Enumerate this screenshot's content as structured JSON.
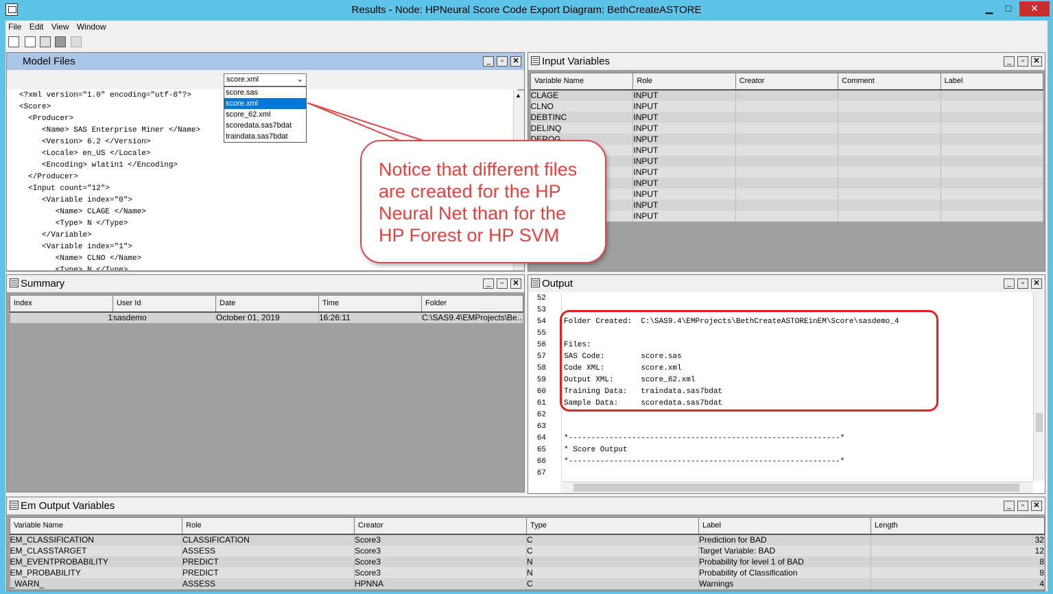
{
  "window": {
    "title": "Results - Node: HPNeural Score Code Export  Diagram: BethCreateASTORE",
    "min": "▁",
    "max": "□",
    "close": "✕"
  },
  "menu": [
    "File",
    "Edit",
    "View",
    "Window"
  ],
  "model_files": {
    "title": "Model Files",
    "dropdown_value": "score.xml",
    "dropdown_options": [
      "score.sas",
      "score.xml",
      "score_62.xml",
      "scoredata.sas7bdat",
      "traindata.sas7bdat"
    ],
    "lines": [
      "<?xml version=\"1.0\" encoding=\"utf-8\"?>",
      "<Score>",
      "  <Producer>",
      "     <Name> SAS Enterprise Miner </Name>",
      "     <Version> 6.2 </Version>",
      "     <Locale> en_US </Locale>",
      "     <Encoding> wlatin1 </Encoding>",
      "  </Producer>",
      "  <Input count=\"12\">",
      "     <Variable index=\"0\">",
      "        <Name> CLAGE </Name>",
      "        <Type> N </Type>",
      "     </Variable>",
      "     <Variable index=\"1\">",
      "        <Name> CLNO </Name>",
      "        <Type> N </Type>"
    ]
  },
  "input_variables": {
    "title": "Input Variables",
    "columns": [
      "Variable Name",
      "Role",
      "Creator",
      "Comment",
      "Label"
    ],
    "rows": [
      [
        "CLAGE",
        "INPUT"
      ],
      [
        "CLNO",
        "INPUT"
      ],
      [
        "DEBTINC",
        "INPUT"
      ],
      [
        "DELINQ",
        "INPUT"
      ],
      [
        "DEROG",
        "INPUT"
      ],
      [
        "",
        "INPUT"
      ],
      [
        "",
        "INPUT"
      ],
      [
        "",
        "INPUT"
      ],
      [
        "",
        "INPUT"
      ],
      [
        "",
        "INPUT"
      ],
      [
        "",
        "INPUT"
      ],
      [
        "",
        "INPUT"
      ]
    ]
  },
  "summary": {
    "title": "Summary",
    "columns": [
      "Index",
      "User Id",
      "Date",
      "Time",
      "Folder"
    ],
    "rows": [
      [
        "1",
        "sasdemo",
        "October 01, 2019",
        "16:26:11",
        "C:\\SAS9.4\\EMProjects\\Be..."
      ]
    ]
  },
  "output": {
    "title": "Output",
    "lines": [
      {
        "n": "52",
        "t": ""
      },
      {
        "n": "53",
        "t": ""
      },
      {
        "n": "54",
        "t": "Folder Created:  C:\\SAS9.4\\EMProjects\\BethCreateASTOREinEM\\Score\\sasdemo_4"
      },
      {
        "n": "55",
        "t": ""
      },
      {
        "n": "56",
        "t": "Files:"
      },
      {
        "n": "57",
        "t": "SAS Code:        score.sas"
      },
      {
        "n": "58",
        "t": "Code XML:        score.xml"
      },
      {
        "n": "59",
        "t": "Output XML:      score_62.xml"
      },
      {
        "n": "60",
        "t": "Training Data:   traindata.sas7bdat"
      },
      {
        "n": "61",
        "t": "Sample Data:     scoredata.sas7bdat"
      },
      {
        "n": "62",
        "t": ""
      },
      {
        "n": "63",
        "t": ""
      },
      {
        "n": "64",
        "t": "*------------------------------------------------------------*"
      },
      {
        "n": "65",
        "t": "* Score Output"
      },
      {
        "n": "66",
        "t": "*------------------------------------------------------------*"
      },
      {
        "n": "67",
        "t": ""
      }
    ]
  },
  "em_output": {
    "title": "Em Output Variables",
    "columns": [
      "Variable Name",
      "Role",
      "Creator",
      "Type",
      "Label",
      "Length"
    ],
    "rows": [
      [
        "EM_CLASSIFICATION",
        "CLASSIFICATION",
        "Score3",
        "C",
        "Prediction for BAD",
        "32"
      ],
      [
        "EM_CLASSTARGET",
        "ASSESS",
        "Score3",
        "C",
        "Target Variable: BAD",
        "12"
      ],
      [
        "EM_EVENTPROBABILITY",
        "PREDICT",
        "Score3",
        "N",
        "Probability for level 1 of BAD",
        "8"
      ],
      [
        "EM_PROBABILITY",
        "PREDICT",
        "Score3",
        "N",
        "Probability of Classification",
        "8"
      ],
      [
        "_WARN_",
        "ASSESS",
        "HPNNA",
        "C",
        "Warnings",
        "4"
      ]
    ]
  },
  "callout": {
    "lines": [
      "Notice that different files",
      "are created for the HP",
      "Neural Net than for the",
      "HP Forest or HP SVM"
    ]
  },
  "colors": {
    "titlebar": "#5fc3e8",
    "callout_red": "#e0433f",
    "highlight_red": "#e02020",
    "selection": "#0078d7"
  }
}
